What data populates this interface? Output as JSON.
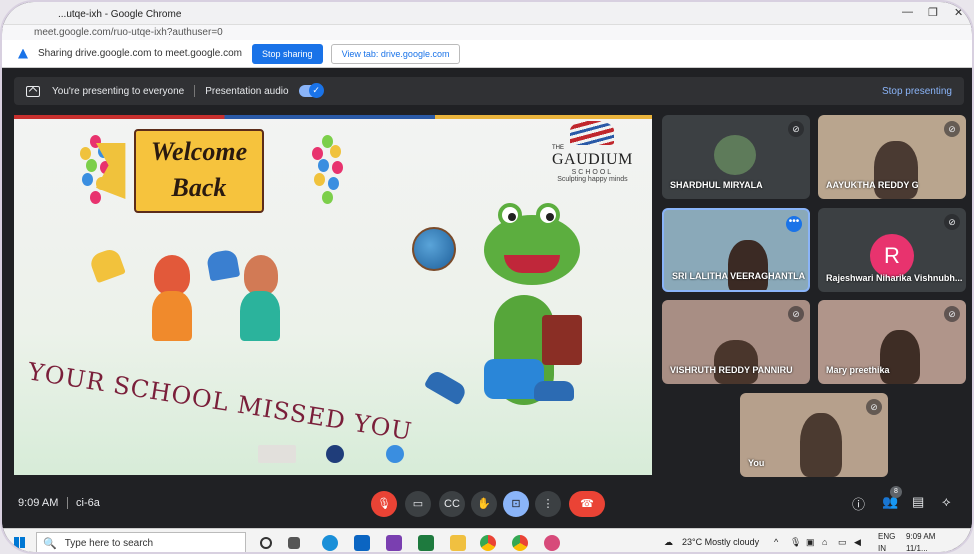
{
  "browser": {
    "window_title": "...utqe-ixh - Google Chrome",
    "url": "meet.google.com/ruo-utqe-ixh?authuser=0"
  },
  "share_banner": {
    "text": "Sharing drive.google.com to meet.google.com",
    "stop_sharing_label": "Stop sharing",
    "view_tab_label": "View tab: drive.google.com"
  },
  "present_bar": {
    "presenting_text": "You're presenting to everyone",
    "audio_label": "Presentation audio",
    "audio_on": true,
    "stop_presenting_label": "Stop presenting"
  },
  "slide": {
    "welcome_line1": "Welcome",
    "welcome_line2": "Back",
    "logo_the": "THE",
    "logo_name": "GAUDIUM",
    "logo_school": "SCHOOL",
    "logo_tagline": "Sculpting happy minds",
    "tagline": "YOUR SCHOOL MISSED YOU",
    "colors": {
      "red": "#c8302e",
      "blue": "#2b5aa6",
      "gold": "#e9b33c",
      "banner": "#f6c33d",
      "text": "#7a1f3a"
    }
  },
  "participants": [
    {
      "name": "SHARDHUL MIRYALA",
      "muted": true
    },
    {
      "name": "AAYUKTHA REDDY G",
      "muted": true
    },
    {
      "name": "SRI LALITHA VEERAGHANTLA",
      "muted": false,
      "active": true
    },
    {
      "name": "Rajeshwari Niharika Vishnubh...",
      "muted": true,
      "avatar_letter": "R"
    },
    {
      "name": "VISHRUTH REDDY PANNIRU",
      "muted": true
    },
    {
      "name": "Mary preethika",
      "muted": true
    },
    {
      "name": "You",
      "muted": true
    }
  ],
  "meeting_bar": {
    "time": "9:09 AM",
    "meeting_code": "ci-6a",
    "participant_count": "8",
    "icons": [
      "mic-off-icon",
      "camera-icon",
      "captions-icon",
      "raise-hand-icon",
      "present-icon",
      "more-icon",
      "end-call-icon",
      "info-icon",
      "people-icon",
      "chat-icon",
      "activities-icon"
    ]
  },
  "taskbar": {
    "search_placeholder": "Type here to search",
    "weather": "23°C  Mostly cloudy",
    "lang_top": "ENG",
    "lang_bottom": "IN",
    "clock_time": "9:09 AM",
    "clock_date": "11/1..."
  }
}
